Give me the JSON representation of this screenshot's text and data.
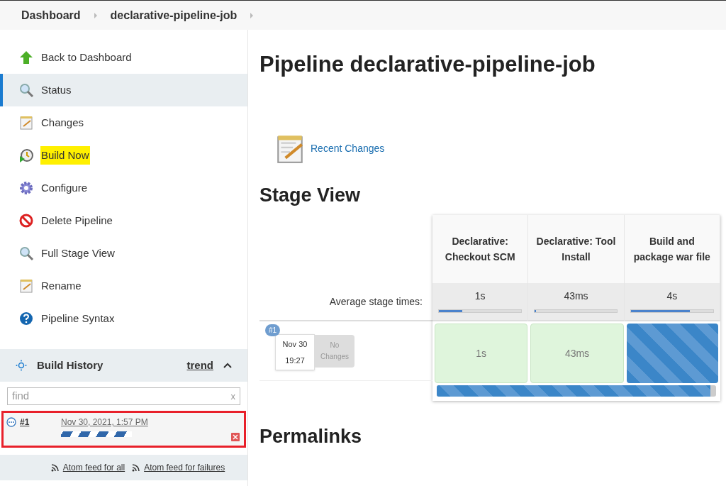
{
  "breadcrumbs": [
    {
      "label": "Dashboard"
    },
    {
      "label": "declarative-pipeline-job"
    }
  ],
  "sidebar": {
    "items": [
      {
        "label": "Back to Dashboard",
        "selected": false,
        "highlighted": false
      },
      {
        "label": "Status",
        "selected": true,
        "highlighted": false
      },
      {
        "label": "Changes",
        "selected": false,
        "highlighted": false
      },
      {
        "label": "Build Now",
        "selected": false,
        "highlighted": true
      },
      {
        "label": "Configure",
        "selected": false,
        "highlighted": false
      },
      {
        "label": "Delete Pipeline",
        "selected": false,
        "highlighted": false
      },
      {
        "label": "Full Stage View",
        "selected": false,
        "highlighted": false
      },
      {
        "label": "Rename",
        "selected": false,
        "highlighted": false
      },
      {
        "label": "Pipeline Syntax",
        "selected": false,
        "highlighted": false
      }
    ]
  },
  "build_history": {
    "title": "Build History",
    "trend": "trend",
    "expanded": true,
    "search": {
      "placeholder": "find",
      "clear": "x"
    },
    "builds": [
      {
        "number": "#1",
        "date": "Nov 30, 2021, 1:57 PM",
        "running": true,
        "highlighted": true
      }
    ],
    "feeds": [
      {
        "label": "Atom feed for all"
      },
      {
        "label": "Atom feed for failures"
      }
    ]
  },
  "main": {
    "title": "Pipeline declarative-pipeline-job",
    "recent_changes": "Recent Changes",
    "stage_view_title": "Stage View",
    "stages": [
      {
        "name": "Declarative: Checkout SCM",
        "avg": "1s",
        "level": 0.28
      },
      {
        "name": "Declarative: Tool Install",
        "avg": "43ms",
        "level": 0.01
      },
      {
        "name": "Build and package war file",
        "avg": "4s",
        "level": 0.72
      }
    ],
    "avg_label": "Average stage times:",
    "run": {
      "badge": "#1",
      "date": "Nov 30",
      "time": "19:27",
      "changes": "No Changes",
      "cells": [
        {
          "kind": "success",
          "text": "1s"
        },
        {
          "kind": "success",
          "text": "43ms"
        },
        {
          "kind": "running"
        }
      ],
      "level": 0.98
    },
    "permalinks_title": "Permalinks"
  }
}
